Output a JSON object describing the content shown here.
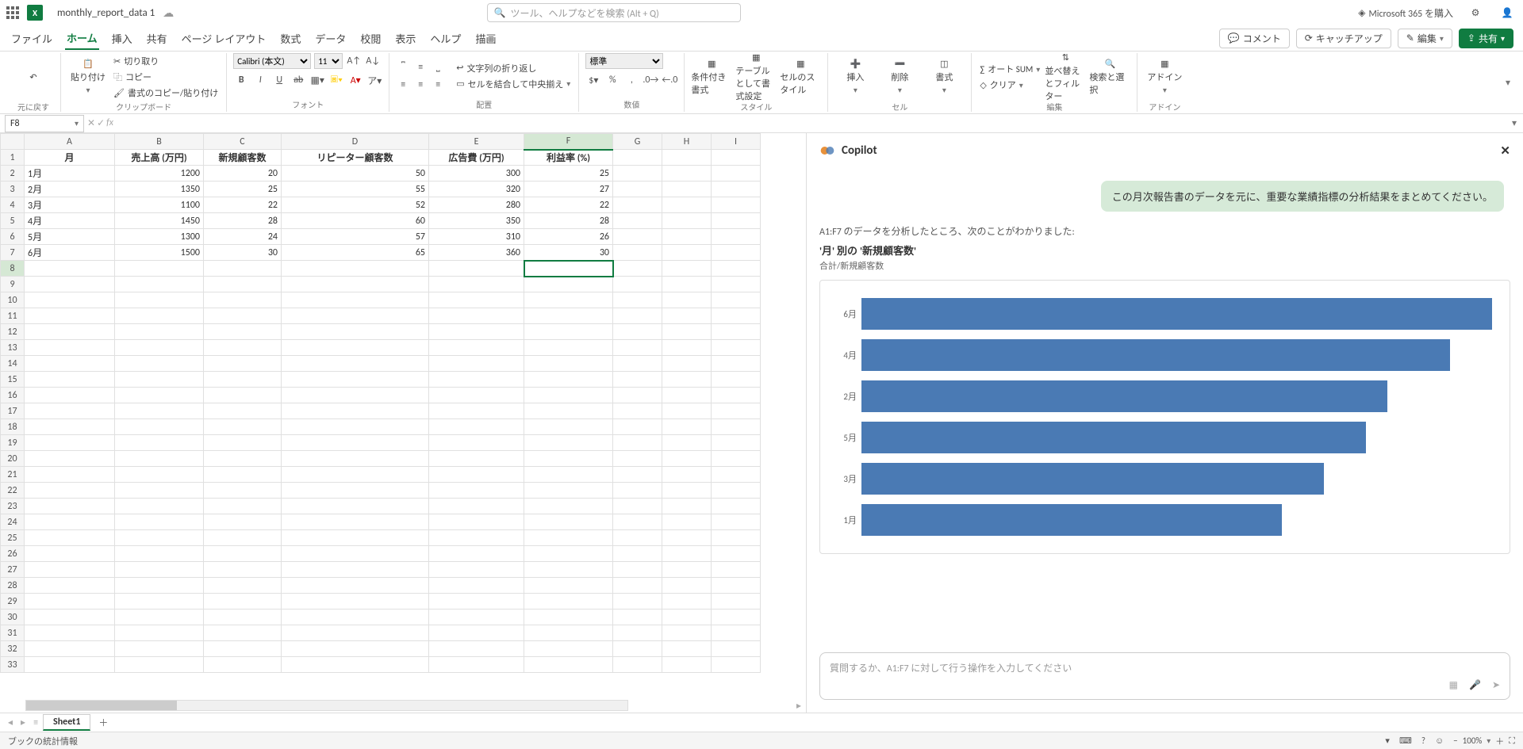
{
  "titlebar": {
    "doc_name": "monthly_report_data 1",
    "search_placeholder": "ツール、ヘルプなどを検索 (Alt + Q)",
    "premium_label": "Microsoft 365 を購入"
  },
  "tabs": {
    "items": [
      "ファイル",
      "ホーム",
      "挿入",
      "共有",
      "ページ レイアウト",
      "数式",
      "データ",
      "校閲",
      "表示",
      "ヘルプ",
      "描画"
    ],
    "active_index": 1,
    "comment_btn": "コメント",
    "catchup_btn": "キャッチアップ",
    "edit_btn": "編集",
    "share_btn": "共有"
  },
  "ribbon": {
    "undo_group": "元に戻す",
    "clipboard": {
      "paste": "貼り付け",
      "cut": "切り取り",
      "copy": "コピー",
      "fmt_paste": "書式のコピー/貼り付け",
      "label": "クリップボード"
    },
    "font": {
      "name": "Calibri (本文)",
      "size": "11",
      "label": "フォント"
    },
    "align": {
      "wrap": "文字列の折り返し",
      "merge": "セルを結合して中央揃え",
      "label": "配置"
    },
    "number": {
      "format": "標準",
      "label": "数値"
    },
    "styles": {
      "cond": "条件付き書式",
      "table": "テーブルとして書式設定",
      "cell": "セルのスタイル",
      "label": "スタイル"
    },
    "cells": {
      "insert": "挿入",
      "delete": "削除",
      "format": "書式",
      "label": "セル"
    },
    "editing": {
      "autosum": "オート SUM",
      "clear": "クリア",
      "sort": "並べ替えとフィルター",
      "find": "検索と選択",
      "label": "編集"
    },
    "addin": {
      "btn": "アドイン",
      "label": "アドイン"
    }
  },
  "namebox": "F8",
  "grid": {
    "columns": [
      "A",
      "B",
      "C",
      "D",
      "E",
      "F",
      "G",
      "H",
      "I"
    ],
    "headers": [
      "月",
      "売上高 (万円)",
      "新規顧客数",
      "リピーター顧客数",
      "広告費 (万円)",
      "利益率 (%)"
    ],
    "rows": [
      {
        "r": 1,
        "cells": [
          "月",
          "売上高 (万円)",
          "新規顧客数",
          "リピーター顧客数",
          "広告費 (万円)",
          "利益率 (%)"
        ],
        "hdr": true
      },
      {
        "r": 2,
        "cells": [
          "1月",
          "1200",
          "20",
          "50",
          "300",
          "25"
        ]
      },
      {
        "r": 3,
        "cells": [
          "2月",
          "1350",
          "25",
          "55",
          "320",
          "27"
        ]
      },
      {
        "r": 4,
        "cells": [
          "3月",
          "1100",
          "22",
          "52",
          "280",
          "22"
        ]
      },
      {
        "r": 5,
        "cells": [
          "4月",
          "1450",
          "28",
          "60",
          "350",
          "28"
        ]
      },
      {
        "r": 6,
        "cells": [
          "5月",
          "1300",
          "24",
          "57",
          "310",
          "26"
        ]
      },
      {
        "r": 7,
        "cells": [
          "6月",
          "1500",
          "30",
          "65",
          "360",
          "30"
        ]
      }
    ],
    "selected_cell": "F8",
    "total_row_hint": 33
  },
  "copilot": {
    "title": "Copilot",
    "user_msg": "この月次報告書のデータを元に、重要な業績指標の分析結果をまとめてください。",
    "analysis_line": "A1:F7 のデータを分析したところ、次のことがわかりました:",
    "chart_title": "'月' 別の '新規顧客数'",
    "chart_sub": "合計/新規顧客数",
    "input_placeholder": "質問するか、A1:F7 に対して行う操作を入力してください"
  },
  "chart_data": {
    "type": "bar",
    "orientation": "horizontal",
    "categories": [
      "6月",
      "4月",
      "2月",
      "5月",
      "3月",
      "1月"
    ],
    "values": [
      30,
      28,
      25,
      24,
      22,
      20
    ],
    "title": "'月' 別の '新規顧客数'",
    "xlabel": "",
    "ylabel": "合計/新規顧客数",
    "xlim": [
      0,
      30
    ]
  },
  "sheet_tabs": {
    "active": "Sheet1"
  },
  "statusbar": {
    "left": "ブックの統計情報",
    "zoom": "100%"
  }
}
